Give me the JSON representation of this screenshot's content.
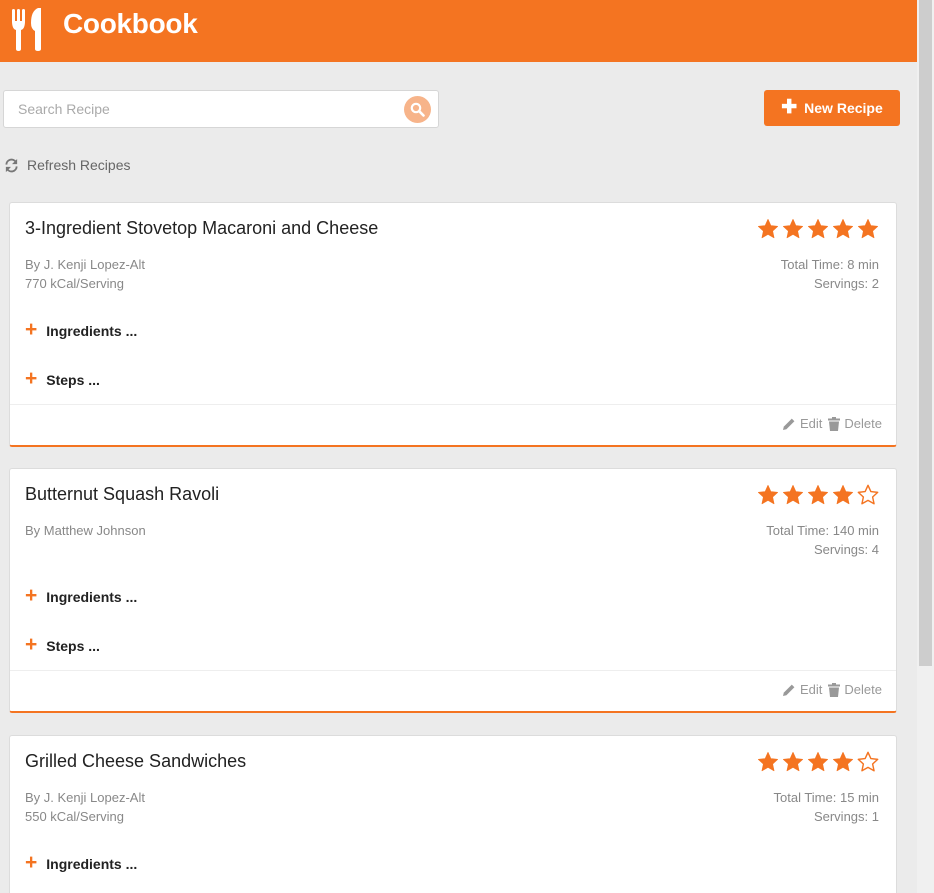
{
  "header": {
    "title": "Cookbook",
    "logo_icon": "fork-spoon-icon"
  },
  "search": {
    "placeholder": "Search Recipe",
    "value": ""
  },
  "new_recipe": {
    "label": "New Recipe"
  },
  "refresh": {
    "label": "Refresh Recipes"
  },
  "labels": {
    "ingredients": "Ingredients ...",
    "steps": "Steps ...",
    "edit": "Edit",
    "delete": "Delete"
  },
  "colors": {
    "accent": "#f47421",
    "background": "#ebebeb",
    "search_button": "#f7b48a"
  },
  "recipes": [
    {
      "name": "3-Ingredient Stovetop Macaroni and Cheese",
      "author": "By J. Kenji Lopez-Alt",
      "kcal": "770 kCal/Serving",
      "total_time": "Total Time: 8 min",
      "servings": "Servings: 2",
      "rating": 5
    },
    {
      "name": "Butternut Squash Ravoli",
      "author": "By Matthew Johnson",
      "kcal": "",
      "total_time": "Total Time: 140 min",
      "servings": "Servings: 4",
      "rating": 4
    },
    {
      "name": "Grilled Cheese Sandwiches",
      "author": "By J. Kenji Lopez-Alt",
      "kcal": "550 kCal/Serving",
      "total_time": "Total Time: 15 min",
      "servings": "Servings: 1",
      "rating": 4
    }
  ]
}
